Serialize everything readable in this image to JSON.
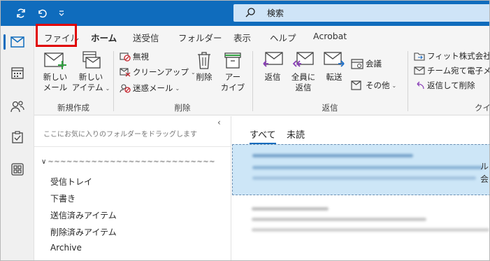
{
  "search": {
    "placeholder": "検索"
  },
  "tabs": [
    {
      "label": "ファイル"
    },
    {
      "label": "ホーム"
    },
    {
      "label": "送受信"
    },
    {
      "label": "フォルダー"
    },
    {
      "label": "表示"
    },
    {
      "label": "ヘルプ"
    },
    {
      "label": "Acrobat"
    }
  ],
  "ribbon": {
    "new_group": {
      "label": "新規作成",
      "new_mail": [
        "新しい",
        "メール"
      ],
      "new_items": [
        "新しい",
        "アイテム"
      ]
    },
    "delete_group": {
      "label": "削除",
      "ignore": "無視",
      "cleanup": "クリーンアップ",
      "junk": "迷惑メール",
      "delete": "削除",
      "archive": [
        "アー",
        "カイブ"
      ]
    },
    "respond_group": {
      "label": "返信",
      "reply": "返信",
      "reply_all": [
        "全員に",
        "返信"
      ],
      "forward": "転送",
      "meeting": "会議",
      "more": "その他"
    },
    "quicksteps_group": {
      "label": "クイ",
      "items": [
        "フィット株式会社",
        "チーム宛て電子メ",
        "返信して削除"
      ]
    }
  },
  "folders": {
    "favorites_hint": "ここにお気に入りのフォルダーをドラッグします",
    "account": "~~~~~~~~~~~~~~~~~~~~~~~~~~~",
    "items": [
      "受信トレイ",
      "下書き",
      "送信済みアイテム",
      "削除済みアイテム",
      "Archive"
    ]
  },
  "message_list": {
    "tabs": [
      "すべて",
      "未読"
    ],
    "side_chars": [
      "ル",
      "会"
    ]
  },
  "colors": {
    "accent": "#0f6cbd",
    "selected": "#cde6f7",
    "highlight": "#e00000"
  }
}
